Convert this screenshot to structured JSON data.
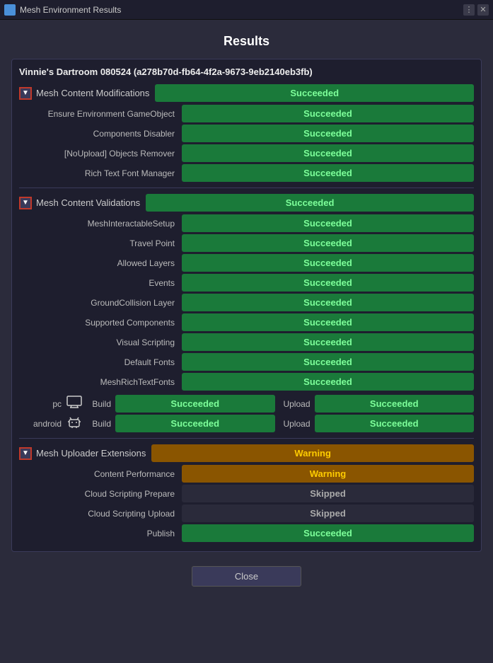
{
  "titleBar": {
    "title": "Mesh Environment Results",
    "moreIcon": "⋮",
    "closeIcon": "✕"
  },
  "main": {
    "title": "Results",
    "helpIcon": "?",
    "environmentName": "Vinnie's Dartroom 080524 (a278b70d-fb64-4f2a-9673-9eb2140eb3fb)",
    "sections": [
      {
        "id": "mesh-content-modifications",
        "label": "Mesh Content Modifications",
        "status": "Succeeded",
        "statusType": "succeeded",
        "rows": [
          {
            "label": "Ensure Environment GameObject",
            "status": "Succeeded",
            "statusType": "succeeded"
          },
          {
            "label": "Components Disabler",
            "status": "Succeeded",
            "statusType": "succeeded"
          },
          {
            "label": "[NoUpload] Objects Remover",
            "status": "Succeeded",
            "statusType": "succeeded"
          },
          {
            "label": "Rich Text Font Manager",
            "status": "Succeeded",
            "statusType": "succeeded"
          }
        ]
      },
      {
        "id": "mesh-content-validations",
        "label": "Mesh Content Validations",
        "status": "Succeeded",
        "statusType": "succeeded",
        "rows": [
          {
            "label": "MeshInteractableSetup",
            "status": "Succeeded",
            "statusType": "succeeded"
          },
          {
            "label": "Travel Point",
            "status": "Succeeded",
            "statusType": "succeeded"
          },
          {
            "label": "Allowed Layers",
            "status": "Succeeded",
            "statusType": "succeeded"
          },
          {
            "label": "Events",
            "status": "Succeeded",
            "statusType": "succeeded"
          },
          {
            "label": "GroundCollision Layer",
            "status": "Succeeded",
            "statusType": "succeeded"
          },
          {
            "label": "Supported Components",
            "status": "Succeeded",
            "statusType": "succeeded"
          },
          {
            "label": "Visual Scripting",
            "status": "Succeeded",
            "statusType": "succeeded"
          },
          {
            "label": "Default Fonts",
            "status": "Succeeded",
            "statusType": "succeeded"
          },
          {
            "label": "MeshRichTextFonts",
            "status": "Succeeded",
            "statusType": "succeeded"
          }
        ],
        "platforms": [
          {
            "name": "pc",
            "icon": "🖥",
            "buildLabel": "Build",
            "buildStatus": "Succeeded",
            "buildStatusType": "succeeded",
            "uploadLabel": "Upload",
            "uploadStatus": "Succeeded",
            "uploadStatusType": "succeeded"
          },
          {
            "name": "android",
            "icon": "🤖",
            "buildLabel": "Build",
            "buildStatus": "Succeeded",
            "buildStatusType": "succeeded",
            "uploadLabel": "Upload",
            "uploadStatus": "Succeeded",
            "uploadStatusType": "succeeded"
          }
        ]
      },
      {
        "id": "mesh-uploader-extensions",
        "label": "Mesh Uploader Extensions",
        "status": "Warning",
        "statusType": "warning",
        "rows": [
          {
            "label": "Content Performance",
            "status": "Warning",
            "statusType": "warning"
          },
          {
            "label": "Cloud Scripting Prepare",
            "status": "Skipped",
            "statusType": "skipped"
          },
          {
            "label": "Cloud Scripting Upload",
            "status": "Skipped",
            "statusType": "skipped"
          },
          {
            "label": "Publish",
            "status": "Succeeded",
            "statusType": "succeeded"
          }
        ]
      }
    ],
    "closeButton": "Close"
  }
}
